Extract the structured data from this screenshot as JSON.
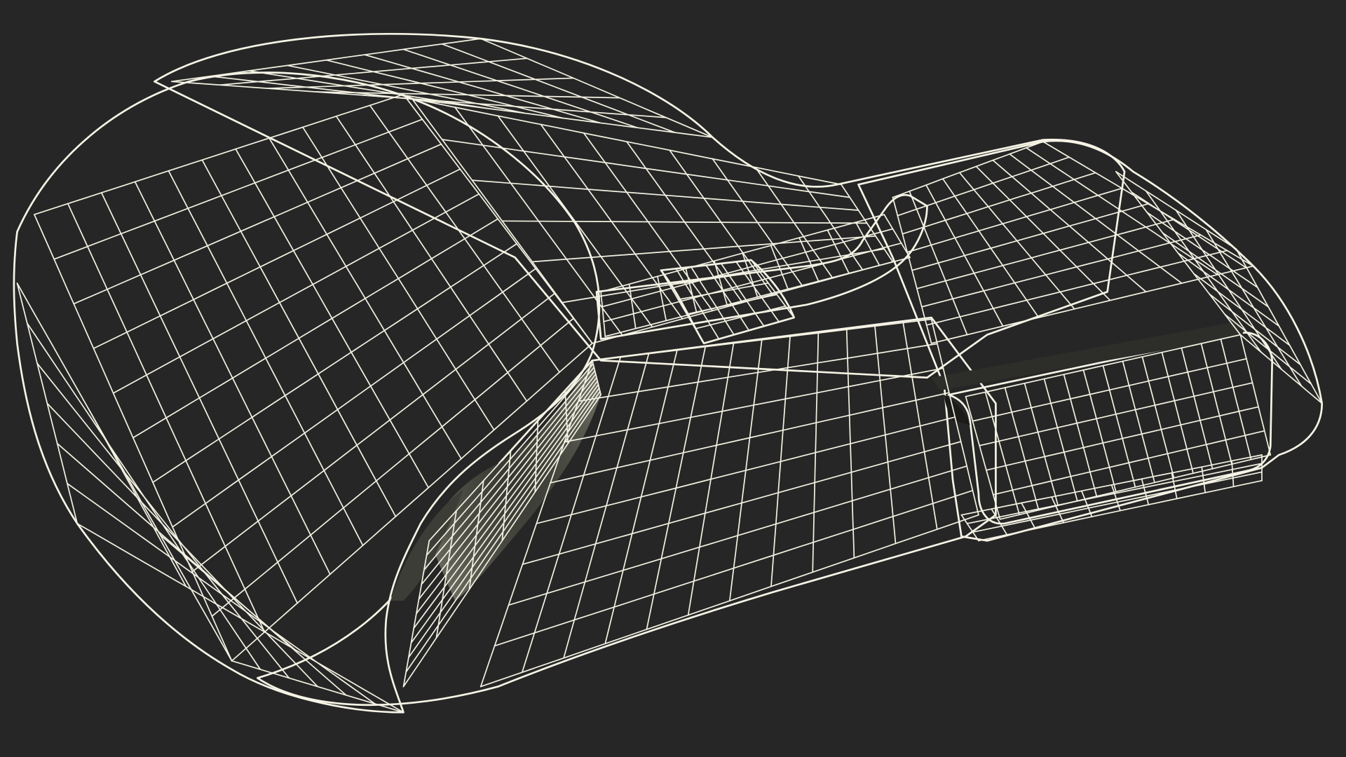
{
  "scene": {
    "subject_icon": "boxing-glove-icon",
    "render_style": "wireframe",
    "colors": {
      "background": "#262626",
      "surface": "#76776a",
      "surface_shadow": "#4a4b42",
      "surface_light": "#8a8b7e",
      "wire": "#f3f1e2"
    }
  }
}
